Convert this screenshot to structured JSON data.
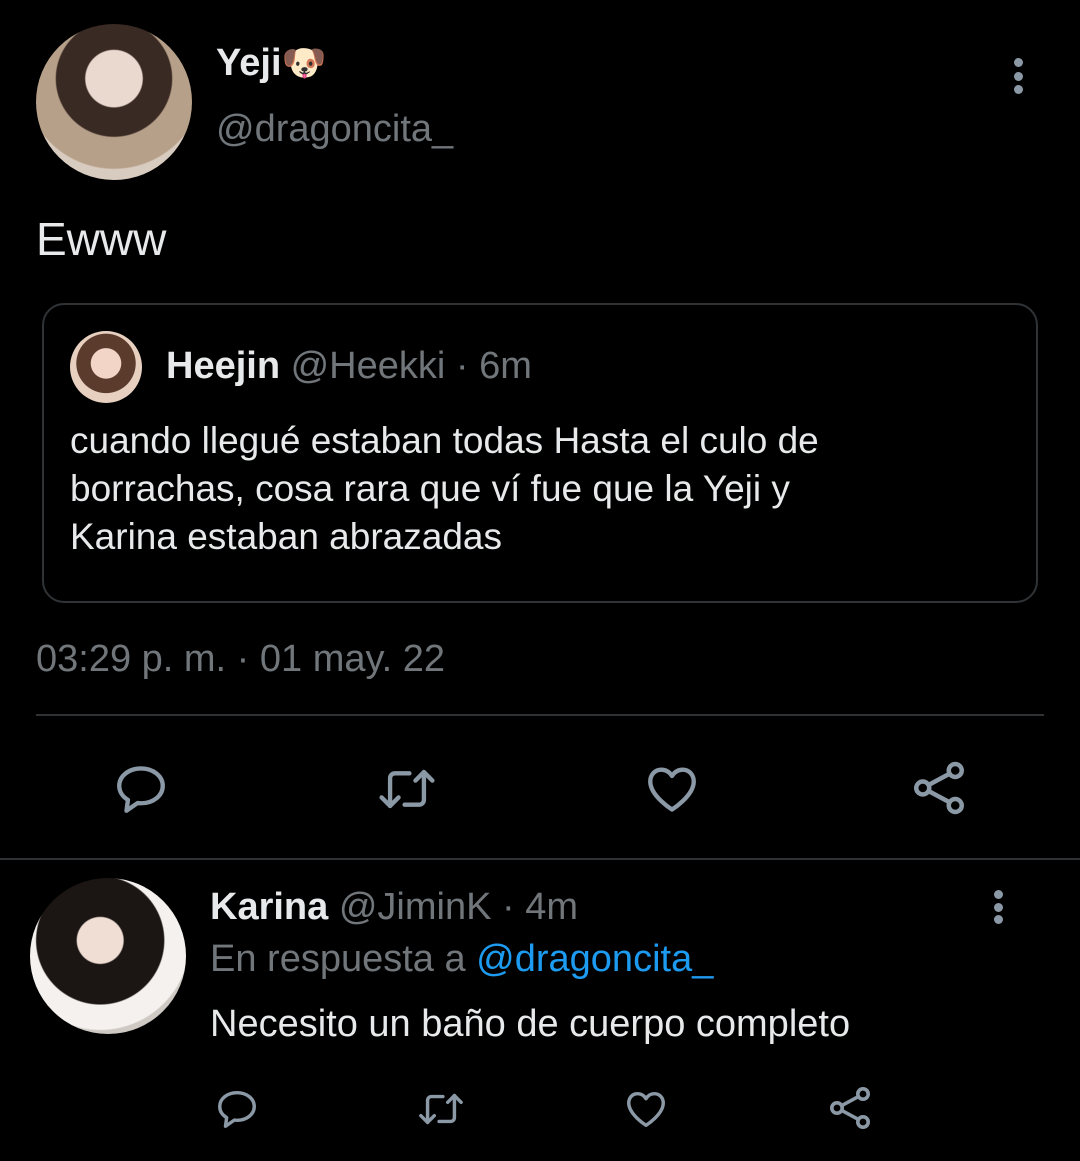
{
  "main_tweet": {
    "display_name": "Yeji",
    "emoji": "🐶",
    "handle": "@dragoncita_",
    "text": "Ewww",
    "timestamp": "03:29 p. m. · 01 may. 22"
  },
  "quoted_tweet": {
    "display_name": "Heejin",
    "handle": "@Heekki",
    "time": "· 6m",
    "text_lines": [
      "cuando llegué estaban todas Hasta el culo de",
      "borrachas, cosa rara que ví fue que la Yeji y",
      "Karina estaban abrazadas"
    ]
  },
  "reply": {
    "display_name": "Karina",
    "handle": "@JiminK",
    "time": "· 4m",
    "replying_to_label": "En respuesta a",
    "replying_to_handle": "@dragoncita_",
    "text": "Necesito un baño de cuerpo completo"
  },
  "icons": {
    "reply": "reply-icon",
    "retweet": "retweet-icon",
    "like": "heart-icon",
    "share": "share-icon",
    "more": "more-vertical-icon"
  },
  "colors": {
    "background": "#000000",
    "text": "#e7e9ea",
    "muted": "#71767b",
    "icon": "#8b98a5",
    "link": "#1d9bf0",
    "border": "#2f3336"
  }
}
